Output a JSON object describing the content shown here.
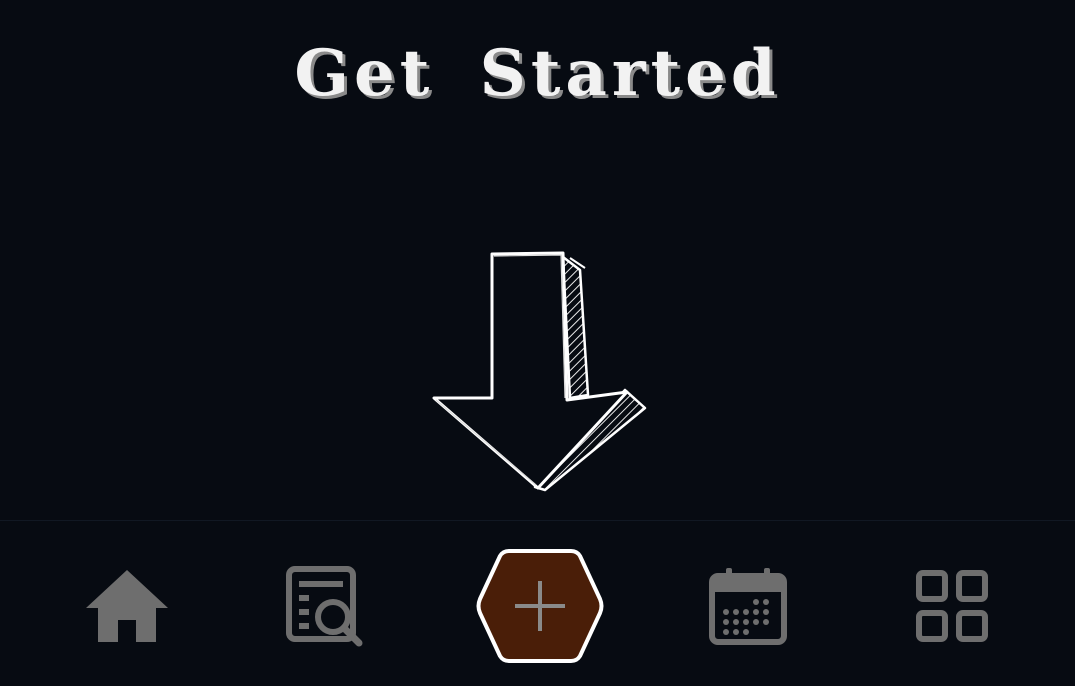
{
  "main": {
    "title": "Get Started",
    "arrow_icon": "hand-drawn-down-arrow-icon"
  },
  "bottom_nav": {
    "items": [
      {
        "id": "home",
        "icon": "home-icon"
      },
      {
        "id": "search-list",
        "icon": "list-search-icon"
      },
      {
        "id": "add",
        "icon": "plus-icon"
      },
      {
        "id": "calendar",
        "icon": "calendar-icon"
      },
      {
        "id": "grid",
        "icon": "grid-icon"
      }
    ]
  },
  "colors": {
    "background": "#070b12",
    "icon_gray": "#6e6e6e",
    "add_button_fill": "#4a1e08",
    "add_button_border": "#ffffff",
    "title_text": "#f2f2f2"
  }
}
